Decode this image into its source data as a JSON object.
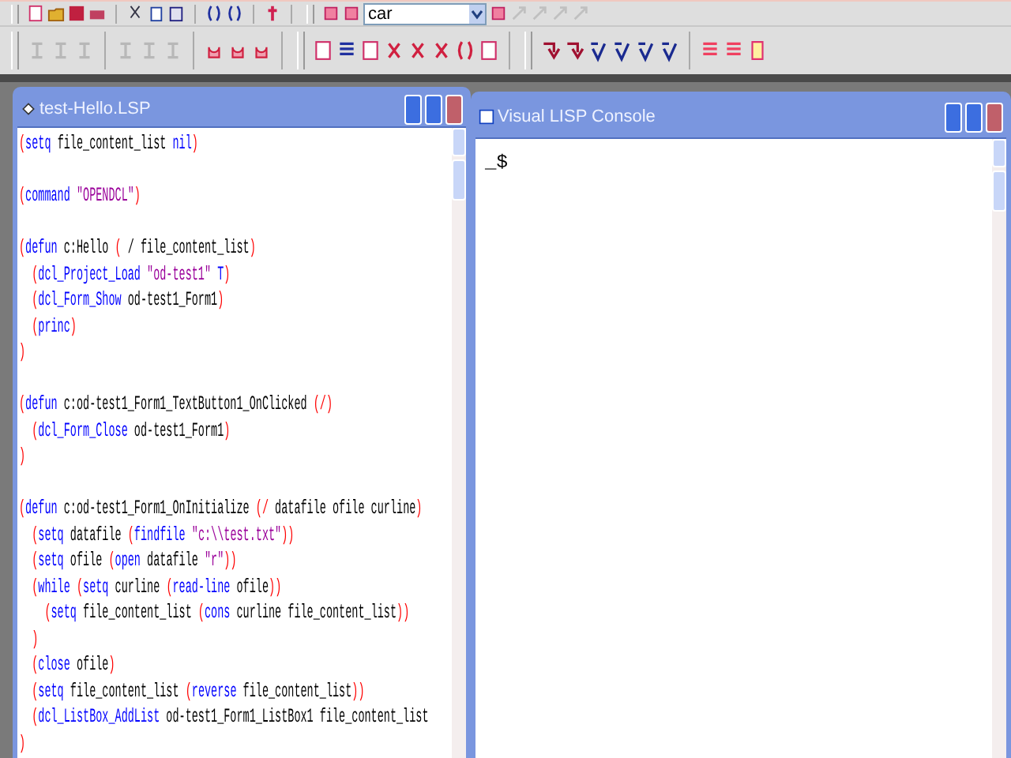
{
  "toolbar": {
    "combo": {
      "value": "car"
    }
  },
  "editor": {
    "title": "test-Hello.LSP",
    "lines": [
      {
        "kind": "code",
        "tokens": [
          {
            "kind": "paren",
            "text": "("
          },
          {
            "kind": "fn",
            "text": "setq"
          },
          {
            "kind": "text",
            "text": " file_content_list "
          },
          {
            "kind": "fn",
            "text": "nil"
          },
          {
            "kind": "paren",
            "text": ")"
          }
        ]
      },
      {
        "kind": "blank"
      },
      {
        "kind": "code",
        "tokens": [
          {
            "kind": "paren",
            "text": "("
          },
          {
            "kind": "fn",
            "text": "command"
          },
          {
            "kind": "str",
            "text": " \"OPENDCL\""
          },
          {
            "kind": "paren",
            "text": ")"
          }
        ]
      },
      {
        "kind": "blank"
      },
      {
        "kind": "code",
        "tokens": [
          {
            "kind": "paren",
            "text": "("
          },
          {
            "kind": "fn",
            "text": "defun"
          },
          {
            "kind": "text",
            "text": " c:Hello "
          },
          {
            "kind": "paren",
            "text": "("
          },
          {
            "kind": "text",
            "text": " / file_content_list"
          },
          {
            "kind": "paren",
            "text": ")"
          }
        ]
      },
      {
        "kind": "code",
        "tokens": [
          {
            "kind": "paren",
            "text": "  ("
          },
          {
            "kind": "fn",
            "text": "dcl_Project_Load"
          },
          {
            "kind": "str",
            "text": " \"od-test1\""
          },
          {
            "kind": "fn",
            "text": " T"
          },
          {
            "kind": "paren",
            "text": ")"
          }
        ]
      },
      {
        "kind": "code",
        "tokens": [
          {
            "kind": "paren",
            "text": "  ("
          },
          {
            "kind": "fn",
            "text": "dcl_Form_Show"
          },
          {
            "kind": "text",
            "text": " od-test1_Form1"
          },
          {
            "kind": "paren",
            "text": ")"
          }
        ]
      },
      {
        "kind": "code",
        "tokens": [
          {
            "kind": "paren",
            "text": "  ("
          },
          {
            "kind": "fn",
            "text": "princ"
          },
          {
            "kind": "paren",
            "text": ")"
          }
        ]
      },
      {
        "kind": "code",
        "tokens": [
          {
            "kind": "paren",
            "text": ")"
          }
        ]
      },
      {
        "kind": "blank"
      },
      {
        "kind": "code",
        "tokens": [
          {
            "kind": "paren",
            "text": "("
          },
          {
            "kind": "fn",
            "text": "defun"
          },
          {
            "kind": "text",
            "text": " c:od-test1_Form1_TextButton1_OnClicked "
          },
          {
            "kind": "paren",
            "text": "(/)"
          }
        ]
      },
      {
        "kind": "code",
        "tokens": [
          {
            "kind": "paren",
            "text": "  ("
          },
          {
            "kind": "fn",
            "text": "dcl_Form_Close"
          },
          {
            "kind": "text",
            "text": " od-test1_Form1"
          },
          {
            "kind": "paren",
            "text": ")"
          }
        ]
      },
      {
        "kind": "code",
        "tokens": [
          {
            "kind": "paren",
            "text": ")"
          }
        ]
      },
      {
        "kind": "blank"
      },
      {
        "kind": "code",
        "tokens": [
          {
            "kind": "paren",
            "text": "("
          },
          {
            "kind": "fn",
            "text": "defun"
          },
          {
            "kind": "text",
            "text": " c:od-test1_Form1_OnInitialize "
          },
          {
            "kind": "paren",
            "text": "(/"
          },
          {
            "kind": "text",
            "text": " datafile ofile curline"
          },
          {
            "kind": "paren",
            "text": ")"
          }
        ]
      },
      {
        "kind": "code",
        "tokens": [
          {
            "kind": "paren",
            "text": "  ("
          },
          {
            "kind": "fn",
            "text": "setq"
          },
          {
            "kind": "text",
            "text": " datafile "
          },
          {
            "kind": "paren",
            "text": "("
          },
          {
            "kind": "fn",
            "text": "findfile"
          },
          {
            "kind": "str",
            "text": " \"c:\\\\test.txt\""
          },
          {
            "kind": "paren",
            "text": "))"
          }
        ]
      },
      {
        "kind": "code",
        "tokens": [
          {
            "kind": "paren",
            "text": "  ("
          },
          {
            "kind": "fn",
            "text": "setq"
          },
          {
            "kind": "text",
            "text": " ofile "
          },
          {
            "kind": "paren",
            "text": "("
          },
          {
            "kind": "fn",
            "text": "open"
          },
          {
            "kind": "text",
            "text": " datafile "
          },
          {
            "kind": "str",
            "text": "\"r\""
          },
          {
            "kind": "paren",
            "text": "))"
          }
        ]
      },
      {
        "kind": "code",
        "tokens": [
          {
            "kind": "paren",
            "text": "  ("
          },
          {
            "kind": "fn",
            "text": "while"
          },
          {
            "kind": "paren",
            "text": " ("
          },
          {
            "kind": "fn",
            "text": "setq"
          },
          {
            "kind": "text",
            "text": " curline "
          },
          {
            "kind": "paren",
            "text": "("
          },
          {
            "kind": "fn",
            "text": "read-line"
          },
          {
            "kind": "text",
            "text": " ofile"
          },
          {
            "kind": "paren",
            "text": "))"
          }
        ]
      },
      {
        "kind": "code",
        "tokens": [
          {
            "kind": "paren",
            "text": "    ("
          },
          {
            "kind": "fn",
            "text": "setq"
          },
          {
            "kind": "text",
            "text": " file_content_list "
          },
          {
            "kind": "paren",
            "text": "("
          },
          {
            "kind": "fn",
            "text": "cons"
          },
          {
            "kind": "text",
            "text": " curline file_content_list"
          },
          {
            "kind": "paren",
            "text": "))"
          }
        ]
      },
      {
        "kind": "code",
        "tokens": [
          {
            "kind": "paren",
            "text": "  )"
          }
        ]
      },
      {
        "kind": "code",
        "tokens": [
          {
            "kind": "paren",
            "text": "  ("
          },
          {
            "kind": "fn",
            "text": "close"
          },
          {
            "kind": "text",
            "text": " ofile"
          },
          {
            "kind": "paren",
            "text": ")"
          }
        ]
      },
      {
        "kind": "code",
        "tokens": [
          {
            "kind": "paren",
            "text": "  ("
          },
          {
            "kind": "fn",
            "text": "setq"
          },
          {
            "kind": "text",
            "text": " file_content_list "
          },
          {
            "kind": "paren",
            "text": "("
          },
          {
            "kind": "fn",
            "text": "reverse"
          },
          {
            "kind": "text",
            "text": " file_content_list"
          },
          {
            "kind": "paren",
            "text": "))"
          }
        ]
      },
      {
        "kind": "code",
        "tokens": [
          {
            "kind": "paren",
            "text": "  ("
          },
          {
            "kind": "fn",
            "text": "dcl_ListBox_AddList"
          },
          {
            "kind": "text",
            "text": " od-test1_Form1_ListBox1 file_content_list"
          }
        ]
      },
      {
        "kind": "code",
        "tokens": [
          {
            "kind": "paren",
            "text": ")"
          }
        ]
      }
    ]
  },
  "console": {
    "title": "Visual LISP Console",
    "lines": [
      "_$"
    ]
  }
}
